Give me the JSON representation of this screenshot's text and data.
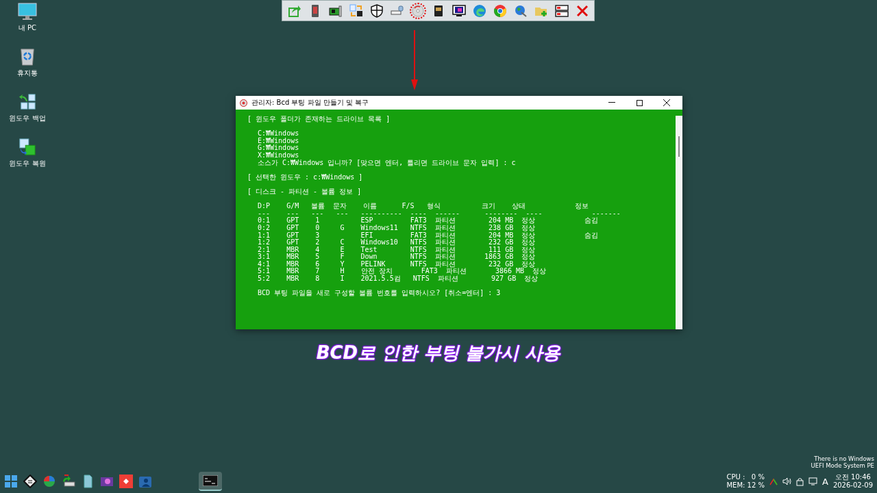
{
  "desktop_icons": [
    {
      "kind": "pc",
      "label": "내 PC"
    },
    {
      "kind": "trash",
      "label": "휴지통"
    },
    {
      "kind": "backup",
      "label": "윈도우 백업"
    },
    {
      "kind": "restore",
      "label": "윈도우 복원"
    }
  ],
  "toolbar": {
    "items": [
      {
        "kind": "share",
        "highlighted": false
      },
      {
        "kind": "card",
        "highlighted": false
      },
      {
        "kind": "board",
        "highlighted": false
      },
      {
        "kind": "swap",
        "highlighted": false
      },
      {
        "kind": "shield",
        "highlighted": false
      },
      {
        "kind": "drive",
        "highlighted": false
      },
      {
        "kind": "disc",
        "highlighted": true
      },
      {
        "kind": "sd",
        "highlighted": false
      },
      {
        "kind": "monitor",
        "highlighted": false
      },
      {
        "kind": "edge",
        "highlighted": false
      },
      {
        "kind": "chrome",
        "highlighted": false
      },
      {
        "kind": "globe",
        "highlighted": false
      },
      {
        "kind": "folder",
        "highlighted": false
      },
      {
        "kind": "server",
        "highlighted": false
      },
      {
        "kind": "close",
        "highlighted": false
      }
    ]
  },
  "window": {
    "title": "관리자: Bcd 부팅 파일 만들기 및 복구",
    "blocks": [
      {
        "kind": "heading",
        "lines": [
          "[ 윈도우 폴더가 존재하는 드라이브 목록 ]"
        ]
      },
      {
        "kind": "body",
        "lines": [
          "C:₩Windows",
          "E:₩Windows",
          "G:₩Windows",
          "X:₩Windows",
          "소스가 C:₩Windows 입니까? [맞으면 엔터, 틀리면 드라이브 문자 입력] : c"
        ]
      },
      {
        "kind": "heading",
        "lines": [
          "[ 선택한 윈도우 : c:₩Windows ]"
        ]
      },
      {
        "kind": "heading",
        "lines": [
          "[ 디스크 - 파티션 - 볼륨 정보 ]"
        ]
      },
      {
        "kind": "body",
        "lines": [
          "D:P    G/M   볼륨  문자    이름      F/S   형식          크기    상태            정보",
          "---    ---   ---   ---   ----------  ----  ------      --------  ----            -------",
          "0:1    GPT    1          ESP         FAT3  파티션        204 MB  정상            숨김",
          "0:2    GPT    0     G    Windows11   NTFS  파티션        238 GB  정상",
          "1:1    GPT    3          EFI         FAT3  파티션        204 MB  정상            숨김",
          "1:2    GPT    2     C    Windows10   NTFS  파티션        232 GB  정상",
          "2:1    MBR    4     E    Test        NTFS  파티션        111 GB  정상",
          "3:1    MBR    5     F    Down        NTFS  파티션       1863 GB  정상",
          "4:1    MBR    6     Y    PELINK      NTFS  파티션        232 GB  정상",
          "5:1    MBR    7     H    안전 장치       FAT3  파티션       3866 MB  정상",
          "5:2    MBR    8     I    2021.5.5컴   NTFS  파티션        927 GB  정상"
        ]
      },
      {
        "kind": "body",
        "lines": [
          "BCD 부팅 파일을 새로 구성할 볼륨 번호를 입력하시오? [취소=엔터] : 3"
        ]
      }
    ]
  },
  "caption": "BCD로 인한 부팅 불가시 사용",
  "notice": [
    "There is no Windows",
    "UEFI Mode System PE"
  ],
  "taskbar": {
    "items": [
      {
        "kind": "start",
        "active": false
      },
      {
        "kind": "disk",
        "active": false
      },
      {
        "kind": "partition",
        "active": false
      },
      {
        "kind": "backup",
        "active": false
      },
      {
        "kind": "file",
        "active": false
      },
      {
        "kind": "media",
        "active": false
      },
      {
        "kind": "remote",
        "active": false
      },
      {
        "kind": "users",
        "active": false
      },
      {
        "kind": "console",
        "active": true
      }
    ],
    "cpu": "CPU :   0 %",
    "mem": "MEM: 12 %",
    "ime": "A",
    "time": "오전 10:46",
    "date": "2026-02-09"
  }
}
